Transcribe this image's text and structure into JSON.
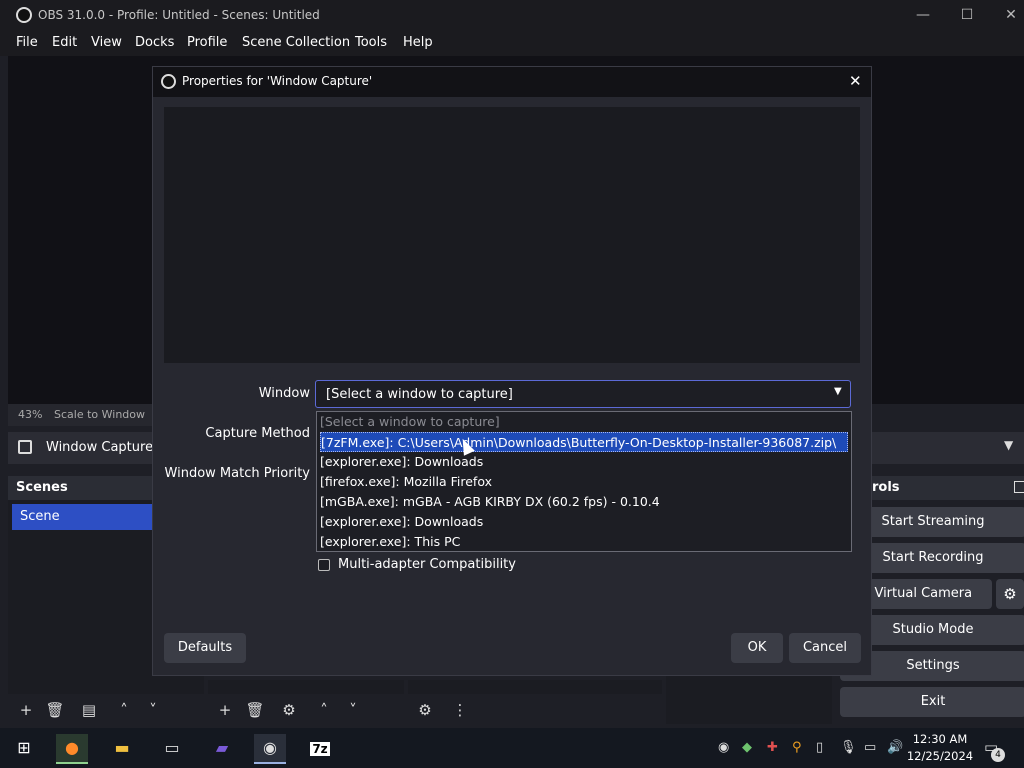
{
  "app": {
    "title": "OBS 31.0.0 - Profile: Untitled - Scenes: Untitled",
    "window_controls": {
      "minimize": "—",
      "maximize": "☐",
      "close": "✕"
    }
  },
  "menu": [
    "File",
    "Edit",
    "View",
    "Docks",
    "Profile",
    "Scene Collection",
    "Tools",
    "Help"
  ],
  "preview": {
    "zoom": "43%",
    "scale_mode": "Scale to Window"
  },
  "source_bar": {
    "source_name": "Window Capture"
  },
  "scenes_dock": {
    "title": "Scenes",
    "items": [
      "Scene"
    ]
  },
  "controls_dock": {
    "title_partial": "rols",
    "buttons": [
      "Start Streaming",
      "Start Recording",
      "rt Virtual Camera",
      "Studio Mode",
      "Settings",
      "Exit"
    ]
  },
  "dialog": {
    "title": "Properties for 'Window Capture'",
    "labels": {
      "window": "Window",
      "capture_method": "Capture Method",
      "match_priority": "Window Match Priority"
    },
    "window_select_value": "[Select a window to capture]",
    "dropdown_options": [
      "[Select a window to capture]",
      "[7zFM.exe]: C:\\Users\\Admin\\Downloads\\Butterfly-On-Desktop-Installer-936087.zip\\",
      "[explorer.exe]: Downloads",
      "[firefox.exe]: Mozilla Firefox",
      "[mGBA.exe]: mGBA - AGB KIRBY DX (60.2 fps) - 0.10.4",
      "[explorer.exe]: Downloads",
      "[explorer.exe]: This PC"
    ],
    "selected_option_index": 1,
    "checkbox_label": "Multi-adapter Compatibility",
    "checkbox_checked": false,
    "buttons": {
      "defaults": "Defaults",
      "ok": "OK",
      "cancel": "Cancel"
    }
  },
  "taskbar": {
    "clock_time": "12:30 AM",
    "clock_date": "12/25/2024",
    "notification_count": "4",
    "app_7z_label": "7z"
  },
  "colors": {
    "accent": "#1e4bb8",
    "scene_selected": "#2d4fc4",
    "recording_marker": "#e03030"
  }
}
